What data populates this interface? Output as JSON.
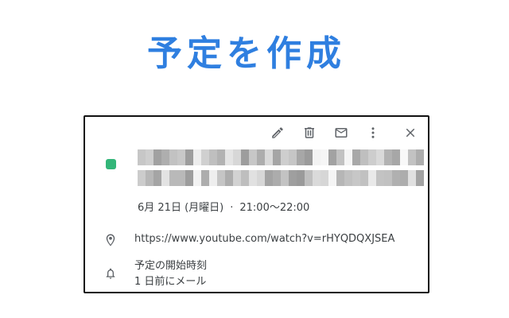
{
  "heading": "予定を作成",
  "event": {
    "color": "#33b679",
    "date": "6月 21日 (月曜日)",
    "separator": "·",
    "time": "21:00〜22:00",
    "url": "https://www.youtube.com/watch?v=rHYQDQXJSEA",
    "reminder": {
      "title": "予定の開始時刻",
      "detail": "1 日前にメール"
    }
  },
  "toolbar": {
    "icons": [
      "edit-icon",
      "delete-icon",
      "email-icon",
      "more-vert-icon",
      "close-icon"
    ]
  },
  "row_icons": [
    "location-pin-icon",
    "bell-icon"
  ]
}
